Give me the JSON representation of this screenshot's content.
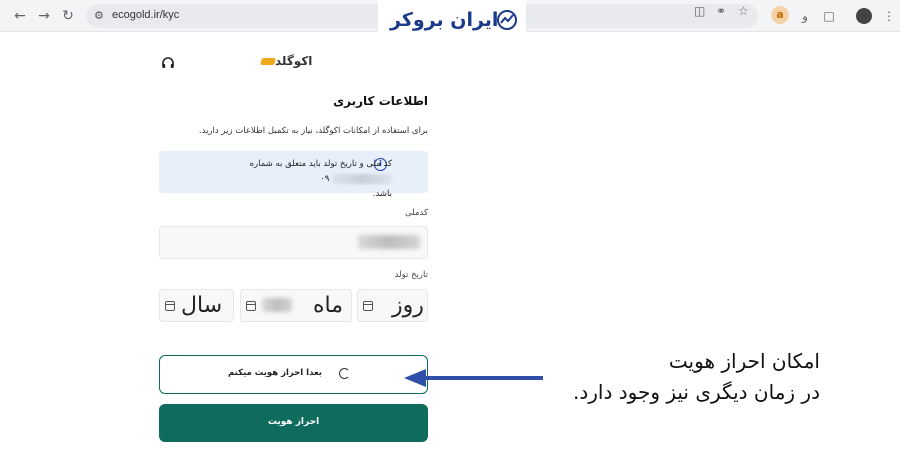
{
  "browser": {
    "url": "ecogold.ir/kyc",
    "icons": [
      "back-arrow",
      "forward-arrow",
      "reload",
      "site-info",
      "screen-share",
      "password-key",
      "bookmark-star",
      "extension-a",
      "translate",
      "extensions-puzzle",
      "profile-avatar",
      "menu-kebab"
    ]
  },
  "watermark": {
    "brand_name": "ایران بروکر"
  },
  "page": {
    "logo_text": "اکوگلد",
    "title": "اطلاعات کاربری",
    "subtitle": "برای استفاده از امکانات اکوگلد، نیاز به تکمیل اطلاعات زیر دارید.",
    "info_text_1": "کد ملی و تاریخ تولد باید متعلق به شماره",
    "info_text_2": "باشد.",
    "info_phone_prefix": "۰۹",
    "national_code_label": "کدملی",
    "birthdate_label": "تاریخ تولد",
    "day_label": "روز",
    "month_label": "ماه",
    "year_label": "سال",
    "later_button": "بعدا احراز هویت میکنم",
    "verify_button": "احراز هویت"
  },
  "annotation": {
    "line1": "امکان احراز هویت",
    "line2": "در زمان دیگری نیز وجود دارد."
  },
  "colors": {
    "primary": "#0f6b5c",
    "info_bg": "#e7effb",
    "arrow": "#2f4fa8",
    "brand_accent": "#f0a81b"
  }
}
